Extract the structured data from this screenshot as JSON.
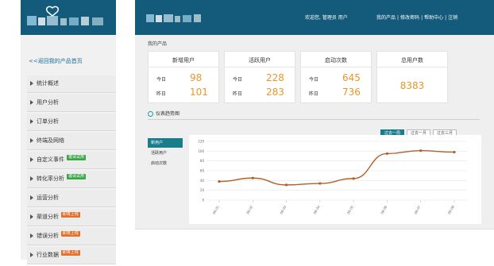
{
  "left": {
    "back_link": "<<返回我的产品首页",
    "menu": [
      {
        "label": "统计概述",
        "badge": "",
        "badge_color": ""
      },
      {
        "label": "用户分析",
        "badge": "",
        "badge_color": ""
      },
      {
        "label": "订单分析",
        "badge": "",
        "badge_color": ""
      },
      {
        "label": "终端及网络",
        "badge": "",
        "badge_color": ""
      },
      {
        "label": "自定义事件",
        "badge": "邀请试用",
        "badge_color": "#3aa447"
      },
      {
        "label": "转化率分析",
        "badge": "邀请试用",
        "badge_color": "#3aa447"
      },
      {
        "label": "运营分析",
        "badge": "",
        "badge_color": ""
      },
      {
        "label": "渠道分析",
        "badge": "即将上线",
        "badge_color": "#e0702c"
      },
      {
        "label": "错误分析",
        "badge": "即将上线",
        "badge_color": "#e0702c"
      },
      {
        "label": "行业数据",
        "badge": "即将上线",
        "badge_color": "#e0702c"
      }
    ]
  },
  "header": {
    "welcome": "欢迎您, 管理员 用户",
    "links": [
      "我的产品",
      "|",
      "修改密码",
      "|",
      "帮助中心",
      "|",
      "注销"
    ]
  },
  "stats": {
    "section_title": "我的产品",
    "cards": [
      {
        "title": "新增用户",
        "today_label": "今日",
        "today": "98",
        "yesterday_label": "昨日",
        "yesterday": "101"
      },
      {
        "title": "活跃用户",
        "today_label": "今日",
        "today": "228",
        "yesterday_label": "昨日",
        "yesterday": "283"
      },
      {
        "title": "启动次数",
        "today_label": "今日",
        "today": "645",
        "yesterday_label": "昨日",
        "yesterday": "736"
      }
    ],
    "total": {
      "title": "总用户数",
      "value": "8383"
    }
  },
  "trend": {
    "title": "仪表趋势图",
    "ranges": [
      "过去一周",
      "过去一月",
      "过去三月"
    ],
    "active_range": 0,
    "metrics": [
      "新用户",
      "活跃用户",
      "启动次数"
    ],
    "active_metric": 0
  },
  "chart_data": {
    "type": "line",
    "title": "",
    "xlabel": "",
    "ylabel": "",
    "y_ticks": [
      0,
      20,
      40,
      60,
      80,
      100,
      120
    ],
    "ylim": [
      0,
      120
    ],
    "categories": [
      "08-01",
      "08-02",
      "08-03",
      "08-04",
      "08-05",
      "08-06",
      "08-07",
      "08-08"
    ],
    "series": [
      {
        "name": "",
        "values": [
          38,
          45,
          31,
          34,
          44,
          95,
          101,
          98
        ]
      }
    ],
    "line_color": "#b45f27",
    "grid": true
  }
}
